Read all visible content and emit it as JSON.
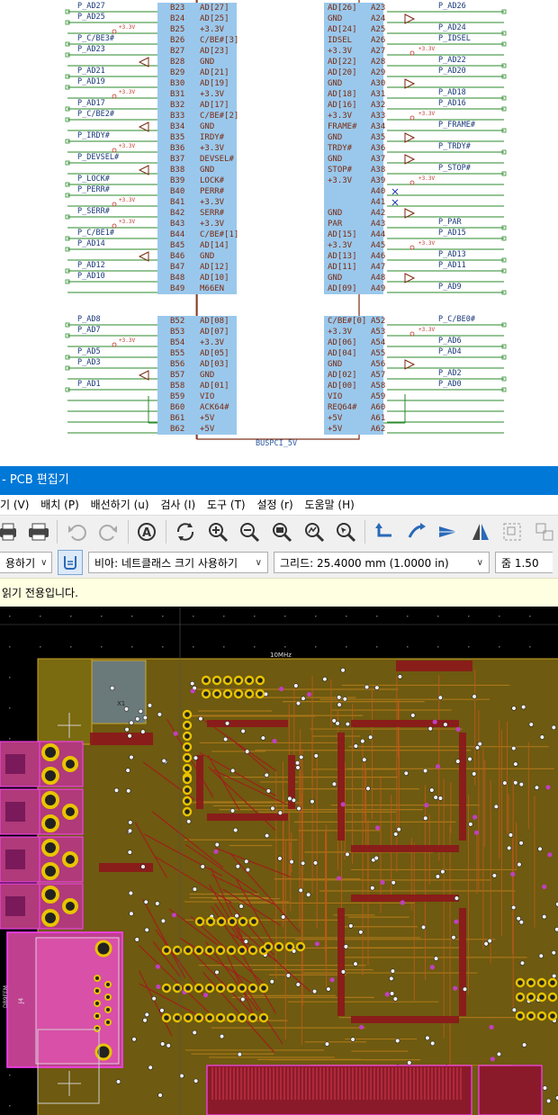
{
  "schematic": {
    "left_pins": [
      "B23",
      "B24",
      "B25",
      "B26",
      "B27",
      "B28",
      "B29",
      "B30",
      "B31",
      "B32",
      "B33",
      "B34",
      "B35",
      "B36",
      "B37",
      "B38",
      "B39",
      "B40",
      "B41",
      "B42",
      "B43",
      "B44",
      "B45",
      "B46",
      "B47",
      "B48",
      "B49",
      "B52",
      "B53",
      "B54",
      "B55",
      "B56",
      "B57",
      "B58",
      "B59",
      "B60",
      "B61",
      "B62"
    ],
    "left_names": [
      "AD[27]",
      "AD[25]",
      "+3.3V",
      "C/BE#[3]",
      "AD[23]",
      "GND",
      "AD[21]",
      "AD[19]",
      "+3.3V",
      "AD[17]",
      "C/BE#[2]",
      "GND",
      "IRDY#",
      "+3.3V",
      "DEVSEL#",
      "GND",
      "LOCK#",
      "PERR#",
      "+3.3V",
      "SERR#",
      "+3.3V",
      "C/BE#[1]",
      "AD[14]",
      "GND",
      "AD[12]",
      "AD[10]",
      "M66EN",
      "AD[08]",
      "AD[07]",
      "+3.3V",
      "AD[05]",
      "AD[03]",
      "GND",
      "AD[01]",
      "VIO",
      "ACK64#",
      "+5V",
      "+5V"
    ],
    "left_nets": [
      "P_AD27",
      "P_AD25",
      "",
      "P_C/BE3#",
      "P_AD23",
      "",
      "P_AD21",
      "P_AD19",
      "",
      "P_AD17",
      "P_C/BE2#",
      "",
      "P_IRDY#",
      "",
      "P_DEVSEL#",
      "",
      "P_LOCK#",
      "P_PERR#",
      "",
      "P_SERR#",
      "",
      "P_C/BE1#",
      "P_AD14",
      "",
      "P_AD12",
      "P_AD10",
      "",
      "P_AD8",
      "P_AD7",
      "",
      "P_AD5",
      "P_AD3",
      "",
      "P_AD1",
      "",
      "",
      "",
      ""
    ],
    "right_pins": [
      "A23",
      "A24",
      "A25",
      "A26",
      "A27",
      "A28",
      "A29",
      "A30",
      "A31",
      "A32",
      "A33",
      "A34",
      "A35",
      "A36",
      "A37",
      "A38",
      "A39",
      "A40",
      "A41",
      "A42",
      "A43",
      "A44",
      "A45",
      "A46",
      "A47",
      "A48",
      "A49",
      "A52",
      "A53",
      "A54",
      "A55",
      "A56",
      "A57",
      "A58",
      "A59",
      "A60",
      "A61",
      "A62"
    ],
    "right_names": [
      "AD[26]",
      "GND",
      "AD[24]",
      "IDSEL",
      "+3.3V",
      "AD[22]",
      "AD[20]",
      "GND",
      "AD[18]",
      "AD[16]",
      "+3.3V",
      "FRAME#",
      "GND",
      "TRDY#",
      "GND",
      "STOP#",
      "+3.3V",
      "",
      "",
      "GND",
      "PAR",
      "AD[15]",
      "+3.3V",
      "AD[13]",
      "AD[11]",
      "GND",
      "AD[09]",
      "C/BE#[0]",
      "+3.3V",
      "AD[06]",
      "AD[04]",
      "GND",
      "AD[02]",
      "AD[00]",
      "VIO",
      "REQ64#",
      "+5V",
      "+5V"
    ],
    "right_nets": [
      "P_AD26",
      "",
      "P_AD24",
      "P_IDSEL",
      "",
      "P_AD22",
      "P_AD20",
      "",
      "P_AD18",
      "P_AD16",
      "",
      "P_FRAME#",
      "",
      "P_TRDY#",
      "",
      "P_STOP#",
      "",
      "",
      "",
      "",
      "P_PAR",
      "P_AD15",
      "",
      "P_AD13",
      "P_AD11",
      "",
      "P_AD9",
      "P_C/BE0#",
      "",
      "P_AD6",
      "P_AD4",
      "",
      "P_AD2",
      "P_AD0",
      "",
      "",
      "",
      ""
    ],
    "component_ref": "BUSPCI_5V",
    "power_label": "+3.3V"
  },
  "titlebar": {
    "title": "- PCB 편집기"
  },
  "menu": {
    "items": [
      "기 (V)",
      "배치 (P)",
      "배선하기 (u)",
      "검사 (I)",
      "도구 (T)",
      "설정 (r)",
      "도움말 (H)"
    ]
  },
  "optbar": {
    "track_select": "용하기",
    "via_select": "비아: 네트클래스 크기 사용하기",
    "grid_select": "그리드: 25.4000 mm (1.0000 in)",
    "zoom_select": "줌 1.50"
  },
  "infobar": {
    "message": "읽기 전용입니다."
  },
  "pcb": {
    "labels": [
      "10MHz",
      "X1",
      "J4",
      "DB9FEM"
    ],
    "colors": {
      "board": "#6e5a10",
      "copper_front": "#a11c1c",
      "copper_back": "#b07a1a",
      "pads": "#e8c400",
      "silk": "#d0d0d0",
      "courtyard": "#ff40ff"
    }
  }
}
